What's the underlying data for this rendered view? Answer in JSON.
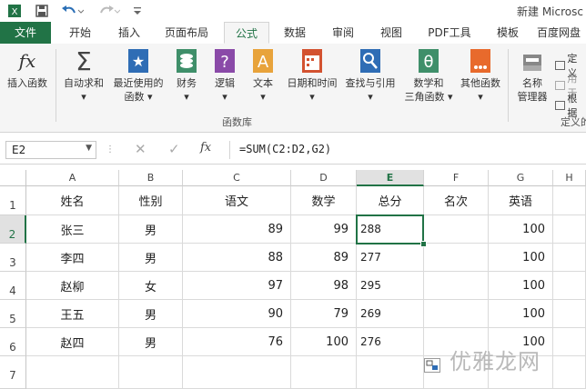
{
  "window": {
    "title": "新建 Microsc"
  },
  "tabs": [
    "文件",
    "开始",
    "插入",
    "页面布局",
    "公式",
    "数据",
    "审阅",
    "视图",
    "PDF工具",
    "模板",
    "百度网盘"
  ],
  "ribbon": {
    "buttons": [
      {
        "l1": "插入函数",
        "l2": ""
      },
      {
        "l1": "自动求和",
        "l2": "▾"
      },
      {
        "l1": "最近使用的",
        "l2": "函数 ▾"
      },
      {
        "l1": "财务",
        "l2": "▾"
      },
      {
        "l1": "逻辑",
        "l2": "▾"
      },
      {
        "l1": "文本",
        "l2": "▾"
      },
      {
        "l1": "日期和时间",
        "l2": "▾"
      },
      {
        "l1": "查找与引用",
        "l2": "▾"
      },
      {
        "l1": "数学和",
        "l2": "三角函数 ▾"
      },
      {
        "l1": "其他函数",
        "l2": "▾"
      },
      {
        "l1": "名称",
        "l2": "管理器"
      }
    ],
    "group_label": "函数库",
    "defined_names": [
      "定义",
      "用于",
      "根据"
    ],
    "group2_label": "定义的"
  },
  "formula_bar": {
    "name_box": "E2",
    "fx": "fx",
    "formula": "=SUM(C2:D2,G2)"
  },
  "columns": [
    "A",
    "B",
    "C",
    "D",
    "E",
    "F",
    "G",
    "H"
  ],
  "rows": [
    "1",
    "2",
    "3",
    "4",
    "5",
    "6",
    "7"
  ],
  "table": {
    "headers": [
      "姓名",
      "性别",
      "语文",
      "数学",
      "总分",
      "名次",
      "英语"
    ],
    "data": [
      [
        "张三",
        "男",
        "89",
        "99",
        "288",
        "",
        "100"
      ],
      [
        "李四",
        "男",
        "88",
        "89",
        "277",
        "",
        "100"
      ],
      [
        "赵柳",
        "女",
        "97",
        "98",
        "295",
        "",
        "100"
      ],
      [
        "王五",
        "男",
        "90",
        "79",
        "269",
        "",
        "100"
      ],
      [
        "赵四",
        "男",
        "76",
        "100",
        "276",
        "",
        "100"
      ]
    ]
  },
  "watermark": "优雅龙网",
  "colors": {
    "accent": "#217346"
  }
}
